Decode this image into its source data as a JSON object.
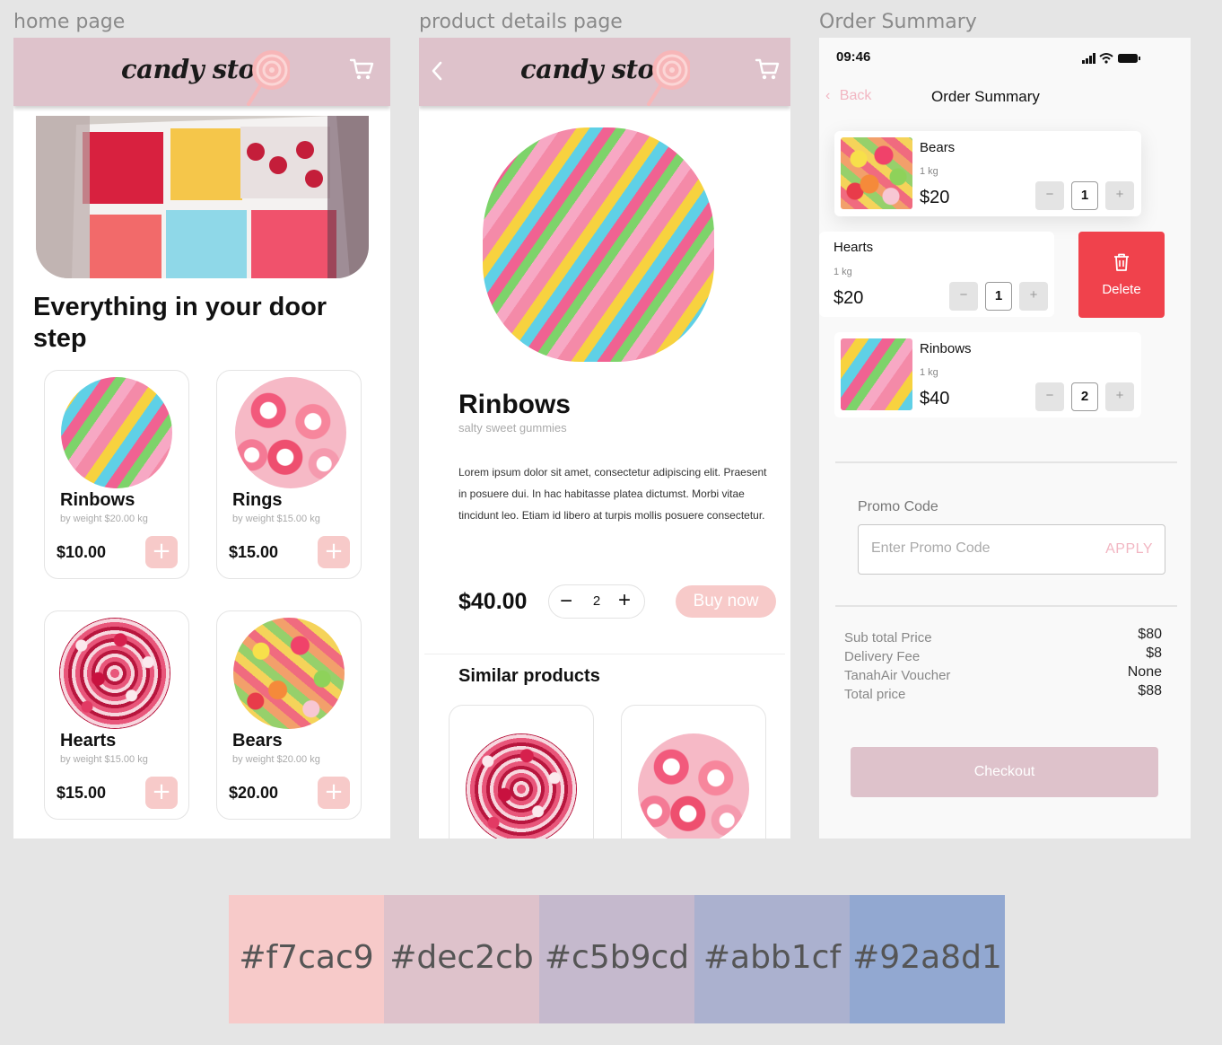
{
  "frames": {
    "home_label": "home page",
    "details_label": "product details page",
    "summary_label": "Order Summary"
  },
  "brand": {
    "logo": "candy store"
  },
  "home": {
    "headline": "Everything in your door step",
    "products": [
      {
        "name": "Rinbows",
        "weight": "by weight $20.00 kg",
        "price": "$10.00",
        "image": "rainbow-belts"
      },
      {
        "name": "Rings",
        "weight": "by weight $15.00 kg",
        "price": "$15.00",
        "image": "gummy-rings"
      },
      {
        "name": "Hearts",
        "weight": "by weight $15.00 kg",
        "price": "$15.00",
        "image": "gummy-hearts"
      },
      {
        "name": "Bears",
        "weight": "by weight $20.00 kg",
        "price": "$20.00",
        "image": "gummy-bears"
      }
    ],
    "add_icon": "+"
  },
  "details": {
    "name": "Rinbows",
    "subtitle": "salty sweet gummies",
    "description": "Lorem ipsum dolor sit amet, consectetur adipiscing elit. Praesent in posuere dui. In hac habitasse platea dictumst. Morbi vitae tincidunt leo. Etiam id libero at turpis mollis posuere consectetur.",
    "price": "$40.00",
    "quantity": "2",
    "minus": "−",
    "plus": "+",
    "buy_label": "Buy now",
    "similar_title": "Similar products"
  },
  "summary": {
    "time": "09:46",
    "back_label": "Back",
    "title": "Order Summary",
    "items": [
      {
        "name": "Bears",
        "weight": "1 kg",
        "price": "$20",
        "qty": "1"
      },
      {
        "name": "Hearts",
        "weight": "1 kg",
        "price": "$20",
        "qty": "1"
      },
      {
        "name": "Rinbows",
        "weight": "1 kg",
        "price": "$40",
        "qty": "2"
      }
    ],
    "minus": "−",
    "plus": "+",
    "delete_label": "Delete",
    "promo_label": "Promo Code",
    "promo_placeholder": "Enter Promo Code",
    "promo_apply": "APPLY",
    "totals": {
      "subtotal_label": "Sub total Price",
      "delivery_label": "Delivery Fee",
      "voucher_label": "TanahAir Voucher",
      "total_label": "Total price",
      "subtotal": "$80",
      "delivery": "$8",
      "voucher": "None",
      "total": "$88"
    },
    "checkout_label": "Checkout"
  },
  "palette": [
    {
      "hex": "#f7cac9",
      "label": "#f7cac9"
    },
    {
      "hex": "#dec2cb",
      "label": "#dec2cb"
    },
    {
      "hex": "#c5b9cd",
      "label": "#c5b9cd"
    },
    {
      "hex": "#abb1cf",
      "label": "#abb1cf"
    },
    {
      "hex": "#92a8d1",
      "label": "#92a8d1"
    }
  ]
}
